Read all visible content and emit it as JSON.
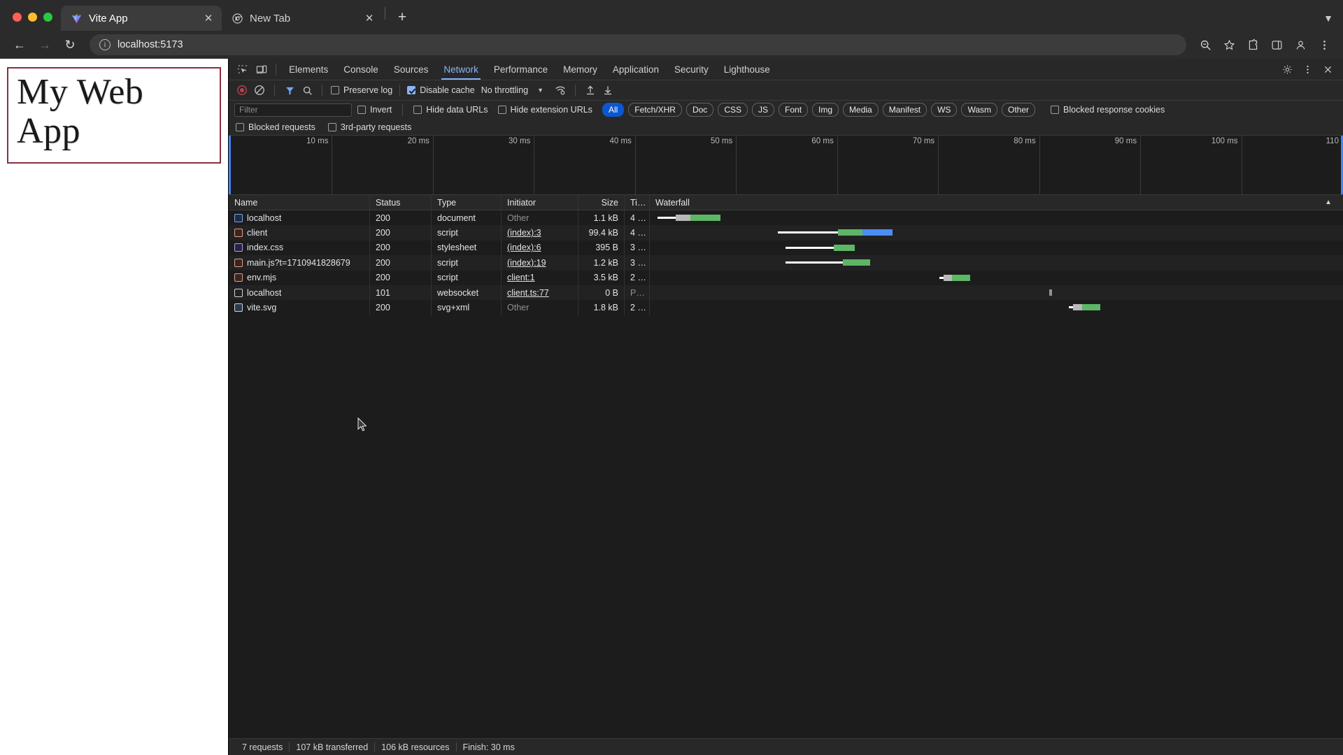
{
  "browser": {
    "tabs": [
      {
        "title": "Vite App",
        "favicon": "vite-logo-icon",
        "active": true
      },
      {
        "title": "New Tab",
        "favicon": "chrome-logo-icon",
        "active": false
      }
    ],
    "newtab_label": "+",
    "address": "localhost:5173",
    "nav": {
      "back": "←",
      "forward": "→",
      "reload": "↻"
    },
    "toolbar_icons": [
      "zoom-icon",
      "bookmark-star-icon",
      "extensions-icon",
      "side-panel-icon",
      "profile-icon",
      "more-menu-icon"
    ]
  },
  "page": {
    "heading": "My Web App"
  },
  "devtools": {
    "panel_tabs": [
      {
        "label": "Elements",
        "active": false
      },
      {
        "label": "Console",
        "active": false
      },
      {
        "label": "Sources",
        "active": false
      },
      {
        "label": "Network",
        "active": true
      },
      {
        "label": "Performance",
        "active": false
      },
      {
        "label": "Memory",
        "active": false
      },
      {
        "label": "Application",
        "active": false
      },
      {
        "label": "Security",
        "active": false
      },
      {
        "label": "Lighthouse",
        "active": false
      }
    ],
    "network_toolbar": {
      "record_state": "recording",
      "clear_label": "clear-icon",
      "filter_toggle": "filter-icon",
      "search_toggle": "search-icon",
      "preserve_log": {
        "label": "Preserve log",
        "checked": false
      },
      "disable_cache": {
        "label": "Disable cache",
        "checked": true
      },
      "throttling": "No throttling",
      "import_label": "import-har-icon",
      "export_label": "export-har-icon",
      "network_conditions_label": "network-conditions-icon"
    },
    "filter_bar": {
      "filter_placeholder": "Filter",
      "filter_value": "",
      "invert": {
        "label": "Invert",
        "checked": false
      },
      "hide_data_urls": {
        "label": "Hide data URLs",
        "checked": false
      },
      "hide_extension_urls": {
        "label": "Hide extension URLs",
        "checked": false
      },
      "types": [
        {
          "label": "All",
          "selected": true
        },
        {
          "label": "Fetch/XHR",
          "selected": false
        },
        {
          "label": "Doc",
          "selected": false
        },
        {
          "label": "CSS",
          "selected": false
        },
        {
          "label": "JS",
          "selected": false
        },
        {
          "label": "Font",
          "selected": false
        },
        {
          "label": "Img",
          "selected": false
        },
        {
          "label": "Media",
          "selected": false
        },
        {
          "label": "Manifest",
          "selected": false
        },
        {
          "label": "WS",
          "selected": false
        },
        {
          "label": "Wasm",
          "selected": false
        },
        {
          "label": "Other",
          "selected": false
        }
      ],
      "blocked_response_cookies": {
        "label": "Blocked response cookies",
        "checked": false
      },
      "blocked_requests": {
        "label": "Blocked requests",
        "checked": false
      },
      "third_party_requests": {
        "label": "3rd-party requests",
        "checked": false
      }
    },
    "overview": {
      "ticks": [
        "10 ms",
        "20 ms",
        "30 ms",
        "40 ms",
        "50 ms",
        "60 ms",
        "70 ms",
        "80 ms",
        "90 ms",
        "100 ms",
        "110"
      ]
    },
    "table": {
      "columns": [
        "Name",
        "Status",
        "Type",
        "Initiator",
        "Size",
        "Ti…",
        "Waterfall"
      ],
      "sort_indicator": "▲",
      "rows": [
        {
          "icon": "document-icon",
          "name": "localhost",
          "status": "200",
          "type": "document",
          "initiator": "Other",
          "initiator_link": false,
          "size": "1.1 kB",
          "time": "4 …",
          "wf": {
            "start": 0.5,
            "wait": 1.2,
            "blockw": 1.0,
            "blockcolor": "#b8b8b8",
            "dl": 2.0,
            "dlcolor": "#5db665"
          }
        },
        {
          "icon": "script-icon",
          "name": "client",
          "status": "200",
          "type": "script",
          "initiator": "(index):3",
          "initiator_link": true,
          "size": "99.4 kB",
          "time": "4 …",
          "wf": {
            "start": 8.5,
            "wait": 4.0,
            "blockw": 1.6,
            "blockcolor": "#5db665",
            "dl": 2.0,
            "dlcolor": "#4b8df8"
          }
        },
        {
          "icon": "stylesheet-icon",
          "name": "index.css",
          "status": "200",
          "type": "stylesheet",
          "initiator": "(index):6",
          "initiator_link": true,
          "size": "395 B",
          "time": "3 …",
          "wf": {
            "start": 9.0,
            "wait": 3.2,
            "blockw": 1.4,
            "blockcolor": "#5db665",
            "dl": 0,
            "dlcolor": "#5db665"
          }
        },
        {
          "icon": "script-icon",
          "name": "main.js?t=1710941828679",
          "status": "200",
          "type": "script",
          "initiator": "(index):19",
          "initiator_link": true,
          "size": "1.2 kB",
          "time": "3 …",
          "wf": {
            "start": 9.0,
            "wait": 3.8,
            "blockw": 1.8,
            "blockcolor": "#5db665",
            "dl": 0,
            "dlcolor": "#5db665"
          }
        },
        {
          "icon": "script-icon",
          "name": "env.mjs",
          "status": "200",
          "type": "script",
          "initiator": "client:1",
          "initiator_link": true,
          "size": "3.5 kB",
          "time": "2 …",
          "wf": {
            "start": 19.2,
            "wait": 0.3,
            "blockw": 0.55,
            "blockcolor": "#b8b8b8",
            "dl": 1.2,
            "dlcolor": "#5db665"
          }
        },
        {
          "icon": "websocket-icon",
          "name": "localhost",
          "status": "101",
          "type": "websocket",
          "initiator": "client.ts:77",
          "initiator_link": true,
          "size": "0 B",
          "time": "P…",
          "wf": {
            "start": 26.5,
            "wait": 0,
            "blockw": 0.2,
            "blockcolor": "#8f9295",
            "dl": 0,
            "dlcolor": "#5db665"
          }
        },
        {
          "icon": "image-icon",
          "name": "vite.svg",
          "status": "200",
          "type": "svg+xml",
          "initiator": "Other",
          "initiator_link": false,
          "size": "1.8 kB",
          "time": "2 …",
          "wf": {
            "start": 27.8,
            "wait": 0.3,
            "blockw": 0.6,
            "blockcolor": "#b8b8b8",
            "dl": 1.2,
            "dlcolor": "#5db665"
          }
        }
      ]
    },
    "statusbar": {
      "requests": "7 requests",
      "transferred": "107 kB transferred",
      "resources": "106 kB resources",
      "finish": "Finish: 30 ms"
    }
  },
  "colors": {
    "accent": "#8ab4f8",
    "select": "#0b57d0",
    "download": "#5db665",
    "wait": "#ffffff",
    "page_border": "#8a2f3f"
  }
}
